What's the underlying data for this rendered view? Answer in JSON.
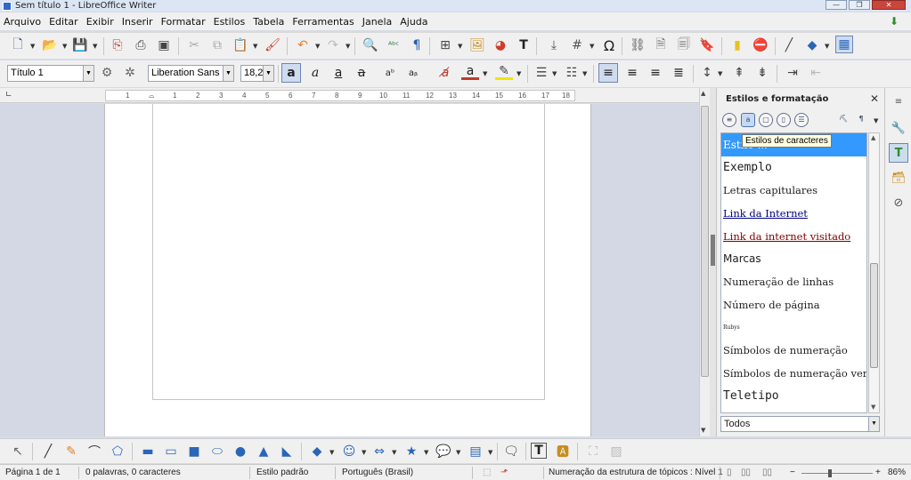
{
  "window": {
    "title": "Sem título 1 - LibreOffice Writer"
  },
  "menu": [
    "Arquivo",
    "Editar",
    "Exibir",
    "Inserir",
    "Formatar",
    "Estilos",
    "Tabela",
    "Ferramentas",
    "Janela",
    "Ajuda"
  ],
  "formatting": {
    "paragraph_style": "Título 1",
    "font_name": "Liberation Sans",
    "font_size": "18,2"
  },
  "ruler": {
    "ticks": [
      "1",
      "1",
      "2",
      "3",
      "4",
      "5",
      "6",
      "7",
      "8",
      "9",
      "10",
      "11",
      "12",
      "13",
      "14",
      "15",
      "16",
      "17",
      "18"
    ]
  },
  "sidebar": {
    "title": "Estilos e formatação",
    "tooltip": "Estilos de caracteres",
    "styles": [
      {
        "label": "Estilo ...",
        "style": "selected"
      },
      {
        "label": "Exemplo",
        "style": "mono"
      },
      {
        "label": "Letras capitulares",
        "style": "serif"
      },
      {
        "label": "Link da Internet",
        "style": "link"
      },
      {
        "label": "Link da internet visitado",
        "style": "visited"
      },
      {
        "label": "Marcas",
        "style": "sans"
      },
      {
        "label": "Numeração de linhas",
        "style": "serif"
      },
      {
        "label": "Número de página",
        "style": "serif"
      },
      {
        "label": "Rubys",
        "style": "tiny"
      },
      {
        "label": "Símbolos de numeração",
        "style": "serif"
      },
      {
        "label": "Símbolos de numeração vertical",
        "style": "serif"
      },
      {
        "label": "Teletipo",
        "style": "mono"
      }
    ],
    "filter": "Todos"
  },
  "status": {
    "page": "Página 1 de 1",
    "words": "0 palavras, 0 caracteres",
    "page_style": "Estilo padrão",
    "language": "Português (Brasil)",
    "outline": "Numeração da estrutura de tópicos : Nível 1",
    "zoom": "86%"
  }
}
